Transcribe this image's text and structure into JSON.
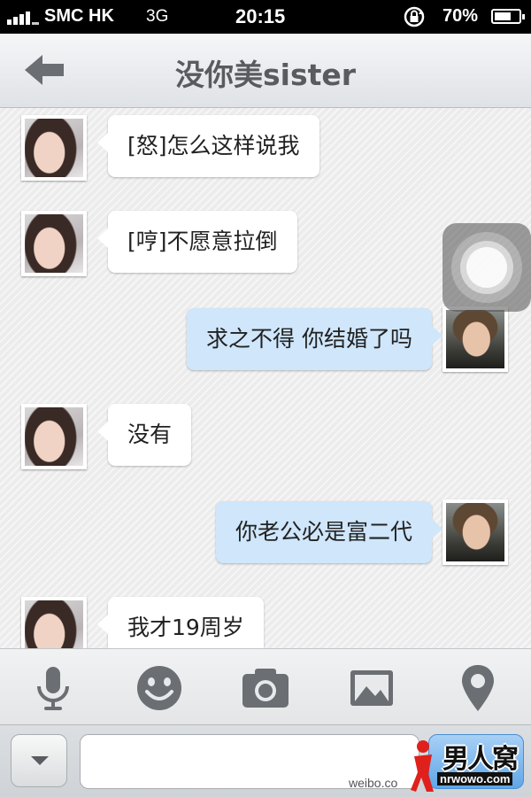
{
  "status_bar": {
    "carrier": "SMC HK",
    "network": "3G",
    "time": "20:15",
    "battery_percent": "70%",
    "battery_level": 0.7,
    "icons": [
      "signal-icon",
      "rotation-lock-icon",
      "battery-icon"
    ]
  },
  "nav": {
    "title": "没你美sister",
    "back_icon": "back-arrow-icon"
  },
  "messages": [
    {
      "sender": "contact",
      "text": "[怒]怎么这样说我"
    },
    {
      "sender": "contact",
      "text": "[哼]不愿意拉倒"
    },
    {
      "sender": "me",
      "text": "求之不得 你结婚了吗"
    },
    {
      "sender": "contact",
      "text": "没有"
    },
    {
      "sender": "me",
      "text": "你老公必是富二代"
    },
    {
      "sender": "contact",
      "text": "我才19周岁"
    }
  ],
  "toolbar": {
    "tools": [
      "microphone-icon",
      "emoji-icon",
      "camera-icon",
      "photo-album-icon",
      "location-pin-icon"
    ]
  },
  "input": {
    "value": "",
    "placeholder": ""
  },
  "watermark": {
    "source_text": "weibo.co",
    "logo_name": "男人窝",
    "logo_url": "nrwowo.com"
  },
  "colors": {
    "incoming_bubble": "#ffffff",
    "outgoing_bubble": "#cfe6fb",
    "send_button": "#5fa6e8"
  }
}
